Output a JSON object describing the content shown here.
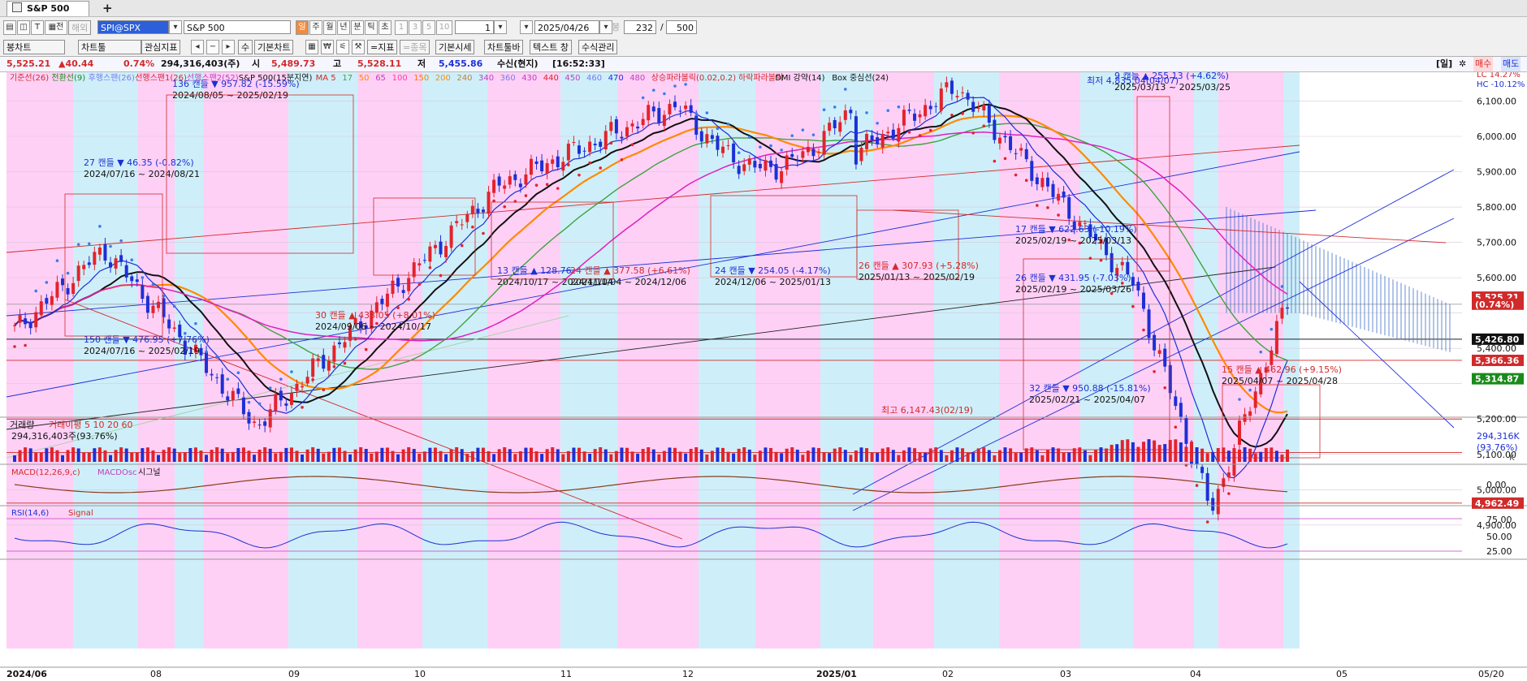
{
  "tab": {
    "title": "S&P 500"
  },
  "toolbar1": {
    "overseas": "해외",
    "symbol_code": "SPI@SPX",
    "symbol_name": "S&P 500",
    "periods": [
      "일",
      "주",
      "월",
      "년",
      "분",
      "틱",
      "초"
    ],
    "nums": [
      "1",
      "3",
      "5",
      "10"
    ],
    "interval": "1",
    "date": "2025/04/26",
    "count_label": "봉",
    "count": "232",
    "slash": "/",
    "total": "500"
  },
  "toolbar2": {
    "chart_type": "봉차트",
    "chart_tool": "차트툴",
    "watch": "관심지표",
    "count_btn": "수",
    "basic_chart": "기본차트",
    "indicator": "=지표",
    "item": "=종목",
    "basic_price": "기본시세",
    "toolbar": "차트툴바",
    "text_win": "텍스트 창",
    "formula": "수식관리"
  },
  "pricebar": {
    "price": "5,525.21",
    "change": "▲40.44",
    "pct": "0.74%",
    "volume": "294,316,403(주)",
    "open_label": "시",
    "open": "5,489.73",
    "high_label": "고",
    "high": "5,528.11",
    "low_label": "저",
    "low": "5,455.86",
    "status": "수신(현지)",
    "time": "[16:52:33]",
    "mode_label": "[일]",
    "buy": "매수",
    "sell": "매도"
  },
  "legend": {
    "items": [
      "기준선(26)",
      "전환선(9)",
      "후행스팬(26)",
      "선행스팬1(26)",
      "선행스팬2(52)",
      "S&P 500(15분지연)",
      "MA 5",
      "17",
      "50",
      "65",
      "100",
      "150",
      "200",
      "240",
      "340",
      "360",
      "430",
      "440",
      "450",
      "460",
      "470",
      "480",
      "상승파라볼릭(0.02,0.2)",
      "하락파라볼릭",
      "DMI 강약(14)",
      "Box 중심선(24)"
    ]
  },
  "axis": {
    "price_ticks": [
      "6,100.00",
      "6,000.00",
      "5,900.00",
      "5,800.00",
      "5,700.00",
      "5,600.00",
      "5,400.00",
      "5,200.00",
      "5,100.00",
      "5,000.00",
      "4,900.00"
    ],
    "price_tags": [
      {
        "text": "5,525.21",
        "color": "#d12a2a"
      },
      {
        "text": "(0.74%)",
        "color": "#d12a2a"
      },
      {
        "text": "5,426.80",
        "color": "#111111"
      },
      {
        "text": "5,366.36",
        "color": "#d12a2a"
      },
      {
        "text": "5,314.87",
        "color": "#1a8a1a"
      },
      {
        "text": "4,962.49",
        "color": "#d12a2a"
      }
    ],
    "lc": "LC  14.27%",
    "hc": "HC  -10.12%",
    "dates": [
      "2024/06",
      "08",
      "09",
      "10",
      "11",
      "12",
      "2025/01",
      "02",
      "03",
      "04",
      "05",
      "05/20"
    ],
    "volume_tag": "294,316K",
    "volume_pct_tag": "(93.76%)",
    "volume_k": "K",
    "macd_tick": "0.00",
    "rsi_ticks": [
      "75.00",
      "50.00",
      "25.00"
    ]
  },
  "annotations": [
    "136 캔들 ▼ 957.82 (-15.59%)",
    "2024/08/05 ~ 2025/02/19",
    "27 캔들 ▼ 46.35 (-0.82%)",
    "2024/07/16 ~ 2024/08/21",
    "13 캔들 ▲ 128.76",
    "2024/10/17 ~ 2024/11/04",
    "24 캔들 ▲ 377.58 (+6.61%)",
    "2024/11/04 ~ 2024/12/06",
    "24 캔들 ▼ 254.05 (-4.17%)",
    "2024/12/06 ~ 2025/01/13",
    "26 캔들 ▲ 307.93 (+5.28%)",
    "2025/01/13 ~ 2025/02/19",
    "30 캔들 ▲ 433.05 (+8.01%)",
    "2024/09/06 ~ 2024/10/17",
    "150 캔들 ▼ 476.95 (+7.76%)",
    "2024/07/16 ~ 2025/02/19",
    "17 캔들 ▼ 622.63 (-10.19%)",
    "2025/02/19 ~ 2025/03/13",
    "26 캔들 ▼ 431.95 (-7.03%)",
    "2025/02/19 ~ 2025/03/26",
    "32 캔들 ▼ 950.88 (-15.81%)",
    "2025/02/21 ~ 2025/04/07",
    "15 캔들 ▲ 462.96 (+9.15%)",
    "2025/04/07 ~ 2025/04/28",
    "9 캔들 ▲ 255.13 (+4.62%)",
    "2025/03/13 ~ 2025/03/25",
    "최저 4,835.04(04/07)",
    "최고 6,147.43(02/19)"
  ],
  "subpanels": {
    "volume_title": "거래량",
    "volume_ma": "거래이평 5  10  20  60",
    "volume_value": "294,316,403주(93.76%)",
    "macd_title": "MACD(12,26,9,c)",
    "macd_osc": "MACDOsc",
    "macd_signal": "시그널",
    "rsi_title": "RSI(14,6)",
    "rsi_signal": "Signal"
  },
  "colors": {
    "up": "#e3232c",
    "down": "#1d2fd6",
    "pink": "#ffc8f4",
    "cyan": "#c6ecf8"
  }
}
